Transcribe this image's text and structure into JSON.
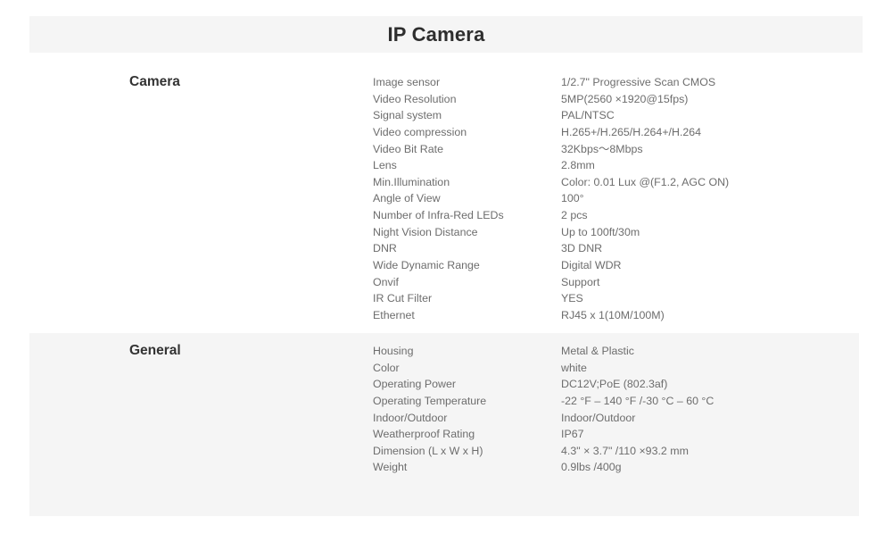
{
  "page": {
    "title": "IP Camera",
    "background_color": "#ffffff",
    "band_color": "#f5f5f5",
    "text_color": "#6d6d6d",
    "heading_color": "#333333"
  },
  "sections": [
    {
      "id": "camera",
      "title": "Camera",
      "shaded": false,
      "rows": [
        {
          "label": "Image sensor",
          "value": "1/2.7\" Progressive Scan CMOS"
        },
        {
          "label": "Video Resolution",
          "value": "5MP(2560 ×1920@15fps)"
        },
        {
          "label": "Signal system",
          "value": "PAL/NTSC"
        },
        {
          "label": "Video compression",
          "value": "H.265+/H.265/H.264+/H.264"
        },
        {
          "label": "Video Bit Rate",
          "value": "32Kbps～8Mbps"
        },
        {
          "label": "Lens",
          "value": "2.8mm"
        },
        {
          "label": "Min.Illumination",
          "value": "Color: 0.01 Lux @(F1.2, AGC ON)"
        },
        {
          "label": "Angle of View",
          "value": "100°"
        },
        {
          "label": "Number of Infra-Red LEDs",
          "value": "2 pcs"
        },
        {
          "label": "Night Vision Distance",
          "value": "Up to 100ft/30m"
        },
        {
          "label": "DNR",
          "value": "3D DNR"
        },
        {
          "label": "Wide Dynamic Range",
          "value": "Digital WDR"
        },
        {
          "label": "Onvif",
          "value": "Support"
        },
        {
          "label": "IR Cut Filter",
          "value": "YES"
        },
        {
          "label": "Ethernet",
          "value": "RJ45 x 1(10M/100M)"
        }
      ]
    },
    {
      "id": "general",
      "title": "General",
      "shaded": true,
      "rows": [
        {
          "label": "Housing",
          "value": "Metal & Plastic"
        },
        {
          "label": "Color",
          "value": "white"
        },
        {
          "label": "Operating Power",
          "value": "DC12V;PoE (802.3af)"
        },
        {
          "label": "Operating Temperature",
          "value": "-22 °F – 140 °F /-30 °C – 60 °C"
        },
        {
          "label": "Indoor/Outdoor",
          "value": "Indoor/Outdoor"
        },
        {
          "label": "Weatherproof Rating",
          "value": "IP67"
        },
        {
          "label": "Dimension (L x W x H)",
          "value": "4.3\" × 3.7\"  /110  ×93.2 mm"
        },
        {
          "label": "Weight",
          "value": "0.9lbs /400g"
        }
      ]
    }
  ]
}
